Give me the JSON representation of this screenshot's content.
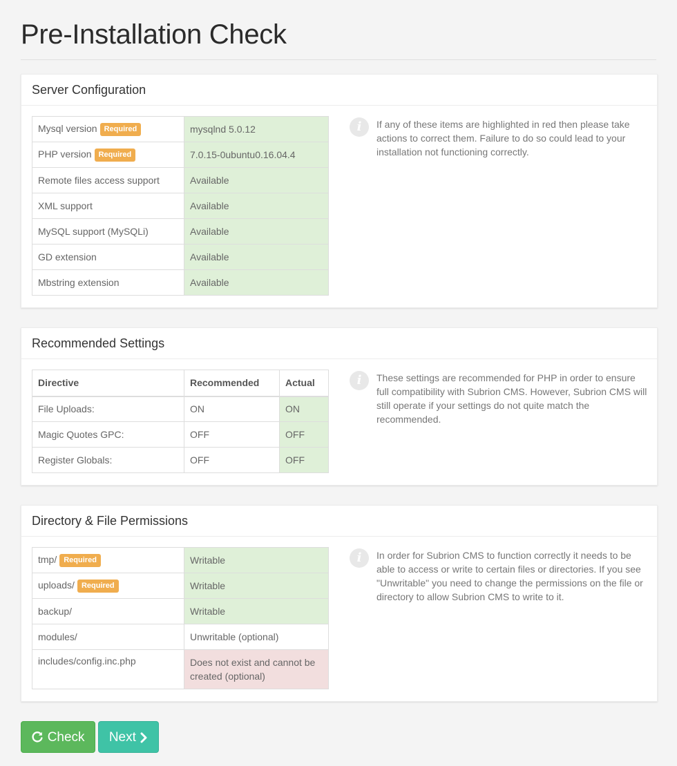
{
  "page_title": "Pre-Installation Check",
  "server_config": {
    "title": "Server Configuration",
    "rows": [
      {
        "name": "Mysql version",
        "required": "Required",
        "value": "mysqlnd 5.0.12",
        "status": "ok"
      },
      {
        "name": "PHP version",
        "required": "Required",
        "value": "7.0.15-0ubuntu0.16.04.4",
        "status": "ok"
      },
      {
        "name": "Remote files access support",
        "value": "Available",
        "status": "ok"
      },
      {
        "name": "XML support",
        "value": "Available",
        "status": "ok"
      },
      {
        "name": "MySQL support (MySQLi)",
        "value": "Available",
        "status": "ok"
      },
      {
        "name": "GD extension",
        "value": "Available",
        "status": "ok"
      },
      {
        "name": "Mbstring extension",
        "value": "Available",
        "status": "ok"
      }
    ],
    "info": "If any of these items are highlighted in red then please take actions to correct them. Failure to do so could lead to your installation not functioning correctly."
  },
  "recommended": {
    "title": "Recommended Settings",
    "headers": [
      "Directive",
      "Recommended",
      "Actual"
    ],
    "rows": [
      {
        "name": "File Uploads:",
        "recommended": "ON",
        "actual": "ON"
      },
      {
        "name": "Magic Quotes GPC:",
        "recommended": "OFF",
        "actual": "OFF"
      },
      {
        "name": "Register Globals:",
        "recommended": "OFF",
        "actual": "OFF"
      }
    ],
    "info": "These settings are recommended for PHP in order to ensure full compatibility with Subrion CMS. However, Subrion CMS will still operate if your settings do not quite match the recommended."
  },
  "permissions": {
    "title": "Directory & File Permissions",
    "rows": [
      {
        "name": "tmp/",
        "required": "Required",
        "value": "Writable",
        "status": "ok"
      },
      {
        "name": "uploads/",
        "required": "Required",
        "value": "Writable",
        "status": "ok"
      },
      {
        "name": "backup/",
        "value": "Writable",
        "status": "ok"
      },
      {
        "name": "modules/",
        "value": "Unwritable (optional)",
        "status": "none"
      },
      {
        "name": "includes/config.inc.php",
        "value": "Does not exist and cannot be created (optional)",
        "status": "bad"
      }
    ],
    "info": "In order for Subrion CMS to function correctly it needs to be able to access or write to certain files or directories. If you see \"Unwritable\" you need to change the permissions on the file or directory to allow Subrion CMS to write to it."
  },
  "buttons": {
    "check": "Check",
    "next": "Next"
  },
  "colors": {
    "ok_bg": "#dff0d8",
    "ok_text": "#3c763d",
    "bad_bg": "#f2dede",
    "bad_text": "#a94442",
    "badge": "#f0ad4e",
    "check_button": "#5cb85c",
    "next_button": "#3fc3a6"
  },
  "icons": {
    "info": "info-icon",
    "check": "refresh-icon",
    "next": "chevron-right-icon"
  }
}
